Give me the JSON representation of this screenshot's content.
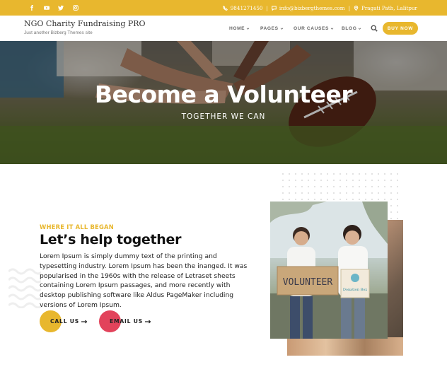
{
  "topbar": {
    "social": [
      "facebook-icon",
      "youtube-icon",
      "twitter-icon",
      "instagram-icon"
    ],
    "phone": "9841271450",
    "email": "info@bizbergthemes.com",
    "address": "Pragati Path, Lalitpur",
    "separator": "|"
  },
  "header": {
    "site_title": "NGO Charity Fundraising PRO",
    "tagline": "Just another Bizberg Themes site",
    "nav": [
      "HOME",
      "PAGES",
      "OUR CAUSES",
      "BLOG"
    ],
    "buy_now": "BUY NOW"
  },
  "hero": {
    "title": "Become a Volunteer",
    "subtitle": "TOGETHER WE CAN"
  },
  "about": {
    "eyebrow": "WHERE IT ALL BEGAN",
    "heading": "Let’s help together",
    "paragraph": "Lorem Ipsum is simply dummy text of the printing and typesetting industry. Lorem Ipsum has been the inanged. It was popularised in the 1960s with the release of Letraset sheets containing Lorem Ipsum passages, and more recently with desktop publishing software like Aldus PageMaker including versions of Lorem Ipsum.",
    "call_label": "CALL US",
    "email_label": "EMAIL US"
  },
  "photo": {
    "sign_text": "VOLUNTEER",
    "box_text": "Donation Box"
  },
  "colors": {
    "accent": "#e8b72e",
    "email_circle": "#e2435b"
  }
}
